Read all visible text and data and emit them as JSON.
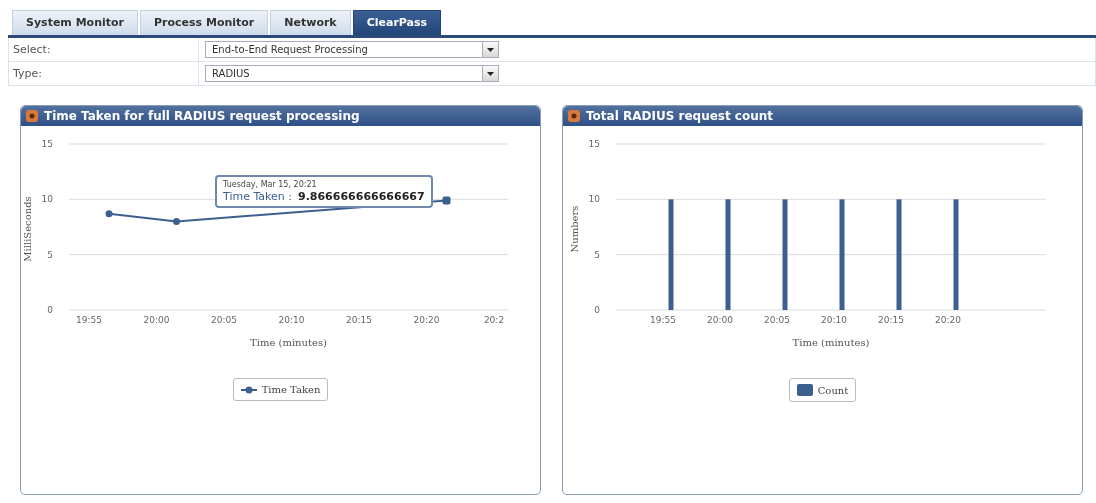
{
  "tabs": [
    {
      "label": "System Monitor",
      "selected": false
    },
    {
      "label": "Process Monitor",
      "selected": false
    },
    {
      "label": "Network",
      "selected": false
    },
    {
      "label": "ClearPass",
      "selected": true
    }
  ],
  "form": [
    {
      "label": "Select:",
      "value": "End-to-End Request Processing"
    },
    {
      "label": "Type:",
      "value": "RADIUS"
    }
  ],
  "panels": [
    {
      "title": "Time Taken for full RADIUS request processing",
      "chart_data": {
        "type": "line",
        "xlabel": "Time (minutes)",
        "ylabel": "MilliSeconds",
        "categories": [
          "19:55",
          "20:00",
          "20:05",
          "20:10",
          "20:15",
          "20:20",
          "20:2"
        ],
        "series": [
          {
            "name": "Time Taken",
            "color": "#3d5f8f",
            "marker": "circle",
            "values": [
              8.7,
              8.0,
              null,
              null,
              null,
              9.9,
              null
            ]
          }
        ],
        "ylim": [
          0,
          15
        ],
        "yticks": [
          0,
          5,
          10,
          15
        ]
      },
      "tooltip": {
        "date": "Tuesday, Mar 15, 20:21",
        "label": "Time Taken :",
        "value": "9.866666666666667"
      }
    },
    {
      "title": "Total RADIUS request count",
      "chart_data": {
        "type": "bar",
        "xlabel": "Time (minutes)",
        "ylabel": "Numbers",
        "categories": [
          "19:55",
          "20:00",
          "20:05",
          "20:10",
          "20:15",
          "20:20"
        ],
        "series": [
          {
            "name": "Count",
            "color": "#3d5f8f",
            "values": [
              10,
              10,
              10,
              10,
              10,
              10
            ]
          }
        ],
        "ylim": [
          0,
          15
        ],
        "yticks": [
          0,
          5,
          10,
          15
        ]
      }
    }
  ]
}
